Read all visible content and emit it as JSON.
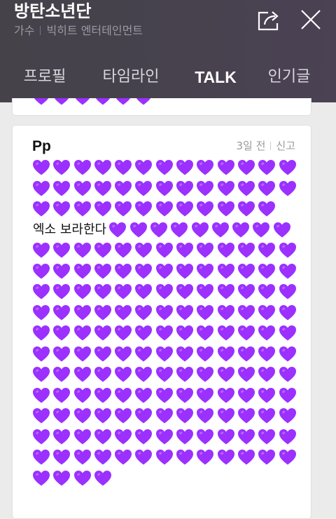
{
  "header": {
    "title": "방탄소년단",
    "category": "가수",
    "agency": "빅히트 엔터테인먼트",
    "share_icon": "share-icon",
    "close_icon": "close-icon"
  },
  "tabs": [
    {
      "label": "프로필",
      "active": false
    },
    {
      "label": "타임라인",
      "active": false
    },
    {
      "label": "TALK",
      "active": true
    },
    {
      "label": "인기글",
      "active": false
    }
  ],
  "colors": {
    "heart": "#9b30ff",
    "header_bg": "#47424e",
    "page_bg": "#ebebeb"
  },
  "previous_post": {
    "visible_heart_count": 6
  },
  "post": {
    "author": "Pp",
    "time": "3일 전",
    "report_label": "신고",
    "hearts_before_text": 38,
    "text": "엑소 보라한다",
    "hearts_after_text": 156,
    "emoji": "purple-heart-emoji"
  }
}
